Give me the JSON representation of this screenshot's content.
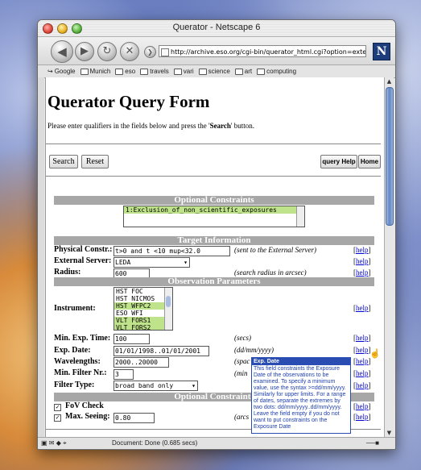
{
  "window": {
    "title": "Querator - Netscape 6"
  },
  "toolbar": {
    "url": "http://archive.eso.org/cgi-bin/querator_html.cgi?option=extern",
    "back_icon": "arrow-left-icon",
    "forward_icon": "arrow-right-icon",
    "reload_icon": "reload-icon",
    "stop_icon": "stop-icon"
  },
  "bookmarks": [
    "Google",
    "Munich",
    "eso",
    "travels",
    "vari",
    "science",
    "art",
    "computing"
  ],
  "page": {
    "title": "Querator Query Form",
    "intro_before": "Please enter qualifiers in the fields below and press the '",
    "intro_bold": "Search",
    "intro_after": "' button.",
    "search_label": "Search",
    "reset_label": "Reset",
    "query_help_label": "query Help",
    "home_label": "Home"
  },
  "sections": {
    "optional_constraints": "Optional Constraints",
    "target_information": "Target Information",
    "observation_parameters": "Observation Parameters",
    "optional_constraints_2": "Optional Constraints"
  },
  "optional_list": [
    "1:Exclusion_of_non_scientific_exposures"
  ],
  "fields": {
    "physical_constr_label": "Physical Constr.:",
    "physical_constr_value": "t>0 and t <10 mup<32.0",
    "physical_constr_note": "(sent to the External Server)",
    "external_server_label": "External Server:",
    "external_server_value": "LEDA",
    "radius_label": "Radius:",
    "radius_value": "600",
    "radius_note": "(search radius in arcsec)",
    "instrument_label": "Instrument:",
    "min_exp_label": "Min. Exp. Time:",
    "min_exp_value": "100",
    "min_exp_note": "(secs)",
    "exp_date_label": "Exp. Date:",
    "exp_date_value": "01/01/1998..01/01/2001",
    "exp_date_note": "(dd/mm/yyyy)",
    "wavelengths_label": "Wavelengths:",
    "wavelengths_value": "2000..20000",
    "wavelengths_note": "(spac",
    "min_filter_label": "Min. Filter Nr.:",
    "min_filter_value": "3",
    "min_filter_note": "(min",
    "filter_type_label": "Filter Type:",
    "filter_type_value": "broad band only",
    "fov_check_label": "FoV Check",
    "max_seeing_label": "Max. Seeing:",
    "max_seeing_value": "0.80",
    "max_seeing_note": "(arcs",
    "help_text": "help"
  },
  "instruments": [
    {
      "name": "HST  FOC",
      "selected": false
    },
    {
      "name": "HST  NICMOS",
      "selected": false
    },
    {
      "name": "HST  WFPC2",
      "selected": true
    },
    {
      "name": "ESO  WFI",
      "selected": false
    },
    {
      "name": "VLT  FORS1",
      "selected": true
    },
    {
      "name": "VLT  FORS2",
      "selected": true
    }
  ],
  "tooltip": {
    "title": "Exp. Date",
    "body": "This field constraints the Exposure Date of the observations to be examined. To specify a minimum value, use the syntax >=dd/mm/yyyy. Similarly for upper limits. For a range of dates, separate the extremes by two dots: dd/mm/yyyy..dd/mm/yyyy. Leave the field empty if you do not want to put constraints on the Exposure Date"
  },
  "status": {
    "text": "Document: Done (0.685 secs)"
  }
}
